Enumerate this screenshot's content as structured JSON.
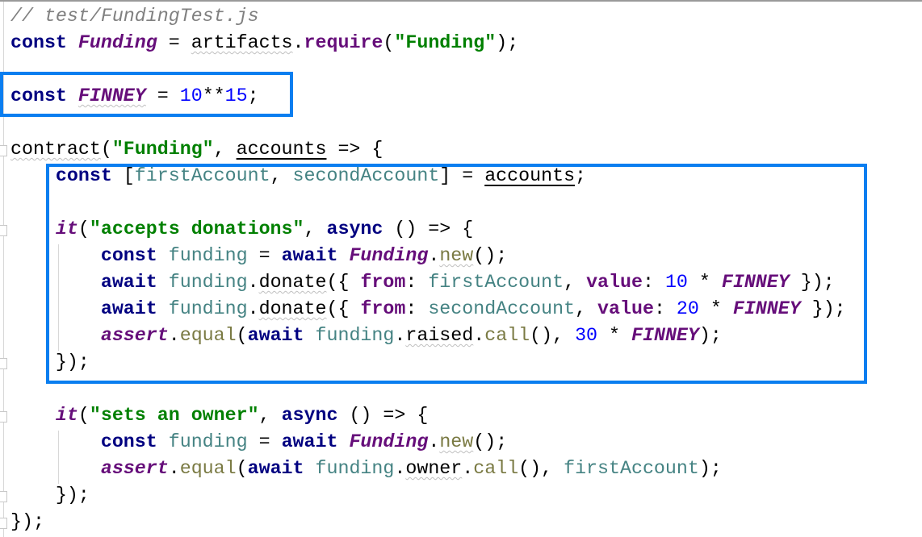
{
  "highlight_color": "#0a7ef0",
  "code": {
    "lines": [
      [
        {
          "t": "// test/FundingTest.js",
          "c": "comment"
        }
      ],
      [
        {
          "t": "const",
          "c": "kw"
        },
        {
          "t": " "
        },
        {
          "t": "Funding",
          "c": "cls"
        },
        {
          "t": " = "
        },
        {
          "t": "artifacts",
          "c": "plain wavy"
        },
        {
          "t": "."
        },
        {
          "t": "require",
          "c": "fn"
        },
        {
          "t": "("
        },
        {
          "t": "\"Funding\"",
          "c": "str"
        },
        {
          "t": ");"
        }
      ],
      [],
      [
        {
          "t": "const",
          "c": "kw"
        },
        {
          "t": " "
        },
        {
          "t": "FINNEY",
          "c": "cls wavy"
        },
        {
          "t": " = "
        },
        {
          "t": "10",
          "c": "num"
        },
        {
          "t": "**"
        },
        {
          "t": "15",
          "c": "num"
        },
        {
          "t": ";"
        }
      ],
      [],
      [
        {
          "t": "contract",
          "c": "plain wavy"
        },
        {
          "t": "("
        },
        {
          "t": "\"Funding\"",
          "c": "str"
        },
        {
          "t": ", "
        },
        {
          "t": "accounts",
          "c": "plain under"
        },
        {
          "t": " => {"
        }
      ],
      [
        {
          "t": "    "
        },
        {
          "t": "const",
          "c": "kw"
        },
        {
          "t": " ["
        },
        {
          "t": "firstAccount",
          "c": "param"
        },
        {
          "t": ", "
        },
        {
          "t": "secondAccount",
          "c": "param"
        },
        {
          "t": "] = "
        },
        {
          "t": "accounts",
          "c": "plain under"
        },
        {
          "t": ";"
        }
      ],
      [],
      [
        {
          "t": "    "
        },
        {
          "t": "it",
          "c": "cls"
        },
        {
          "t": "("
        },
        {
          "t": "\"accepts donations\"",
          "c": "str"
        },
        {
          "t": ", "
        },
        {
          "t": "async",
          "c": "kw"
        },
        {
          "t": " () => {"
        }
      ],
      [
        {
          "t": "        "
        },
        {
          "t": "const",
          "c": "kw"
        },
        {
          "t": " "
        },
        {
          "t": "funding",
          "c": "param"
        },
        {
          "t": " = "
        },
        {
          "t": "await",
          "c": "kw"
        },
        {
          "t": " "
        },
        {
          "t": "Funding",
          "c": "cls"
        },
        {
          "t": "."
        },
        {
          "t": "new",
          "c": "method wavy"
        },
        {
          "t": "();"
        }
      ],
      [
        {
          "t": "        "
        },
        {
          "t": "await",
          "c": "kw"
        },
        {
          "t": " "
        },
        {
          "t": "funding",
          "c": "param"
        },
        {
          "t": "."
        },
        {
          "t": "donate",
          "c": "plain wavy"
        },
        {
          "t": "({ "
        },
        {
          "t": "from",
          "c": "prop"
        },
        {
          "t": ": "
        },
        {
          "t": "firstAccount",
          "c": "param"
        },
        {
          "t": ", "
        },
        {
          "t": "value",
          "c": "prop"
        },
        {
          "t": ": "
        },
        {
          "t": "10",
          "c": "num"
        },
        {
          "t": " * "
        },
        {
          "t": "FINNEY",
          "c": "cls"
        },
        {
          "t": " });"
        }
      ],
      [
        {
          "t": "        "
        },
        {
          "t": "await",
          "c": "kw"
        },
        {
          "t": " "
        },
        {
          "t": "funding",
          "c": "param"
        },
        {
          "t": "."
        },
        {
          "t": "donate",
          "c": "plain wavy"
        },
        {
          "t": "({ "
        },
        {
          "t": "from",
          "c": "prop"
        },
        {
          "t": ": "
        },
        {
          "t": "secondAccount",
          "c": "param"
        },
        {
          "t": ", "
        },
        {
          "t": "value",
          "c": "prop"
        },
        {
          "t": ": "
        },
        {
          "t": "20",
          "c": "num"
        },
        {
          "t": " * "
        },
        {
          "t": "FINNEY",
          "c": "cls"
        },
        {
          "t": " });"
        }
      ],
      [
        {
          "t": "        "
        },
        {
          "t": "assert",
          "c": "cls"
        },
        {
          "t": "."
        },
        {
          "t": "equal",
          "c": "method"
        },
        {
          "t": "("
        },
        {
          "t": "await",
          "c": "kw"
        },
        {
          "t": " "
        },
        {
          "t": "funding",
          "c": "param"
        },
        {
          "t": "."
        },
        {
          "t": "raised",
          "c": "plain wavy"
        },
        {
          "t": "."
        },
        {
          "t": "call",
          "c": "method"
        },
        {
          "t": "(), "
        },
        {
          "t": "30",
          "c": "num"
        },
        {
          "t": " * "
        },
        {
          "t": "FINNEY",
          "c": "cls"
        },
        {
          "t": ");"
        }
      ],
      [
        {
          "t": "    });"
        }
      ],
      [],
      [
        {
          "t": "    "
        },
        {
          "t": "it",
          "c": "cls"
        },
        {
          "t": "("
        },
        {
          "t": "\"sets an owner\"",
          "c": "str"
        },
        {
          "t": ", "
        },
        {
          "t": "async",
          "c": "kw"
        },
        {
          "t": " () => {"
        }
      ],
      [
        {
          "t": "        "
        },
        {
          "t": "const",
          "c": "kw"
        },
        {
          "t": " "
        },
        {
          "t": "funding",
          "c": "param"
        },
        {
          "t": " = "
        },
        {
          "t": "await",
          "c": "kw"
        },
        {
          "t": " "
        },
        {
          "t": "Funding",
          "c": "cls"
        },
        {
          "t": "."
        },
        {
          "t": "new",
          "c": "method wavy"
        },
        {
          "t": "();"
        }
      ],
      [
        {
          "t": "        "
        },
        {
          "t": "assert",
          "c": "cls"
        },
        {
          "t": "."
        },
        {
          "t": "equal",
          "c": "method"
        },
        {
          "t": "("
        },
        {
          "t": "await",
          "c": "kw"
        },
        {
          "t": " "
        },
        {
          "t": "funding",
          "c": "param"
        },
        {
          "t": "."
        },
        {
          "t": "owner",
          "c": "plain wavy"
        },
        {
          "t": "."
        },
        {
          "t": "call",
          "c": "method"
        },
        {
          "t": "(), "
        },
        {
          "t": "firstAccount",
          "c": "param"
        },
        {
          "t": ");"
        }
      ],
      [
        {
          "t": "    });"
        }
      ],
      [
        {
          "t": "});"
        }
      ]
    ]
  }
}
